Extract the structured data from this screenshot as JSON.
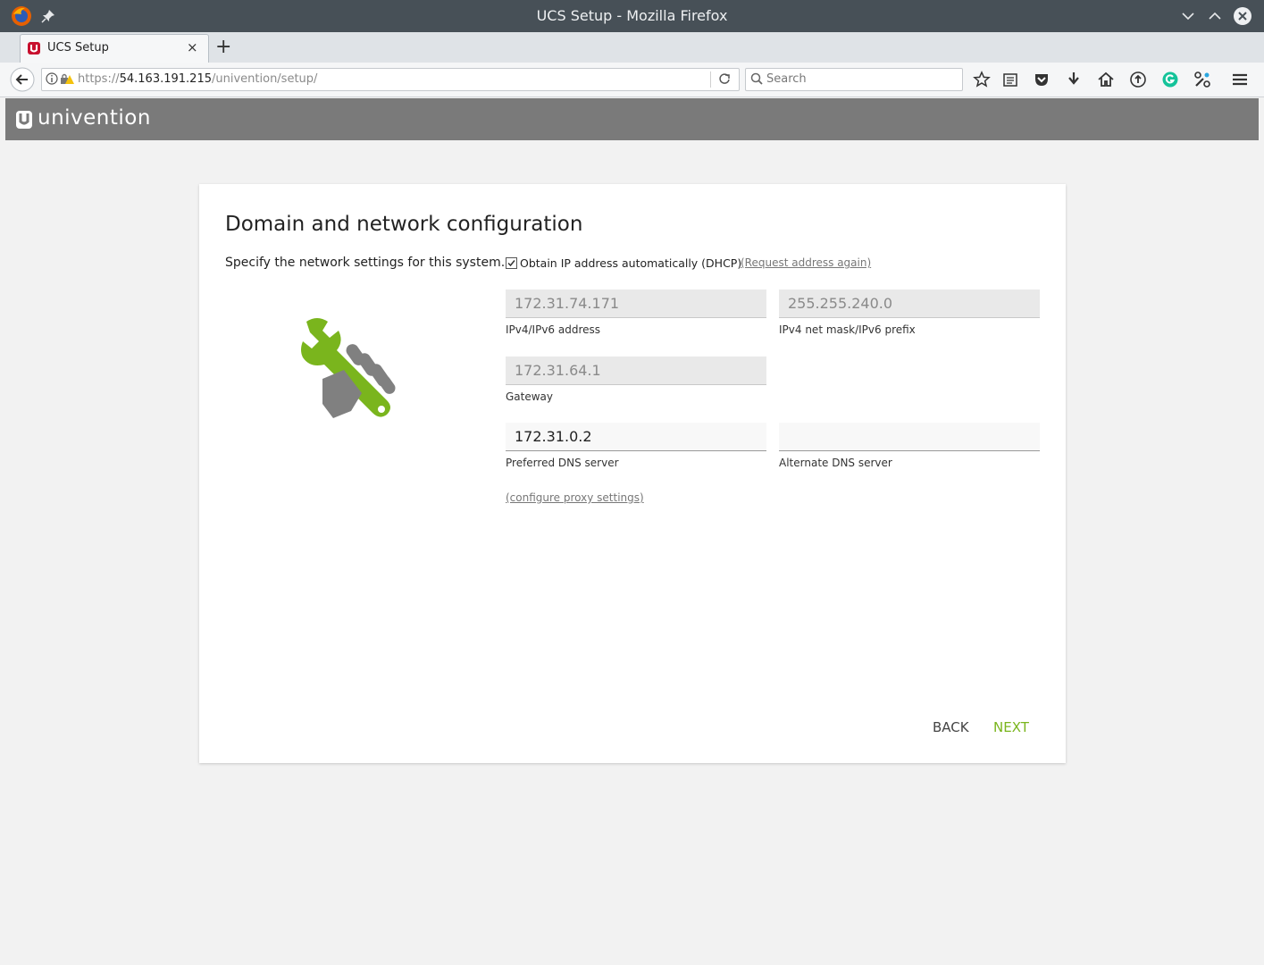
{
  "window": {
    "title": "UCS Setup - Mozilla Firefox"
  },
  "tab": {
    "label": "UCS Setup",
    "close": "×",
    "new_tab": "+"
  },
  "nav": {
    "url_scheme": "https://",
    "url_host": "54.163.191.215",
    "url_path": "/univention/setup/",
    "search_placeholder": "Search"
  },
  "brand": {
    "name": "univention"
  },
  "setup": {
    "title": "Domain and network configuration",
    "description": "Specify the network settings for this system.",
    "dhcp_label": "Obtain IP address automatically (DHCP)",
    "dhcp_checked": true,
    "request_again": "(Request address again)",
    "fields": {
      "ip": {
        "value": "172.31.74.171",
        "label": "IPv4/IPv6 address"
      },
      "netmask": {
        "value": "255.255.240.0",
        "label": "IPv4 net mask/IPv6 prefix"
      },
      "gateway": {
        "value": "172.31.64.1",
        "label": "Gateway"
      },
      "dns1": {
        "value": "172.31.0.2",
        "label": "Preferred DNS server"
      },
      "dns2": {
        "value": "",
        "label": "Alternate DNS server"
      }
    },
    "proxy_link": "(configure proxy settings)",
    "back": "BACK",
    "next": "NEXT"
  },
  "colors": {
    "accent": "#7ab51d",
    "header": "#7a7a7a",
    "titlebar": "#475057"
  }
}
